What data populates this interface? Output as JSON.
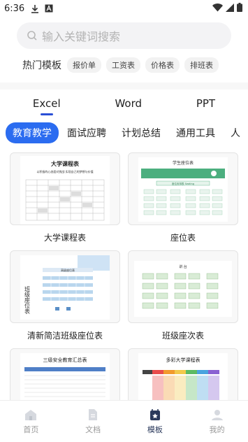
{
  "status": {
    "time": "6:36"
  },
  "search": {
    "placeholder": "输入关键词搜索"
  },
  "hot": {
    "label": "热门模板",
    "tags": [
      "报价单",
      "工资表",
      "价格表",
      "排班表"
    ]
  },
  "format_tabs": [
    "Excel",
    "Word",
    "PPT"
  ],
  "categories": [
    "教育教学",
    "面试应聘",
    "计划总结",
    "通用工具",
    "人"
  ],
  "cards": [
    {
      "title": "大学课程表",
      "thumb_title": "大学课程表",
      "thumb_sub": "以积极的心态面对挑战 实现自己的梦想与价值"
    },
    {
      "title": "座位表",
      "thumb_title": "学生座位表",
      "thumb_sub": "座位安排表 Seating"
    },
    {
      "title": "清新简洁班级座位表",
      "thumb_title": "班级座位表",
      "thumb_sub": "高级座位表"
    },
    {
      "title": "班级座次表",
      "thumb_title": "讲 台",
      "thumb_sub": ""
    },
    {
      "title": "三级安全教育汇总表",
      "thumb_title": "三级安全教育汇总表",
      "thumb_sub": ""
    },
    {
      "title": "多彩大学课程表",
      "thumb_title": "多彩大学课程表",
      "thumb_sub": ""
    }
  ],
  "nav": [
    {
      "label": "首页",
      "icon": "home-icon"
    },
    {
      "label": "文档",
      "icon": "document-icon"
    },
    {
      "label": "模板",
      "icon": "template-icon"
    },
    {
      "label": "我的",
      "icon": "profile-icon"
    }
  ],
  "colors": {
    "accent": "#2b6cf0",
    "tab_underline": "#2a4fd6",
    "nav_active": "#2b3a5c"
  }
}
